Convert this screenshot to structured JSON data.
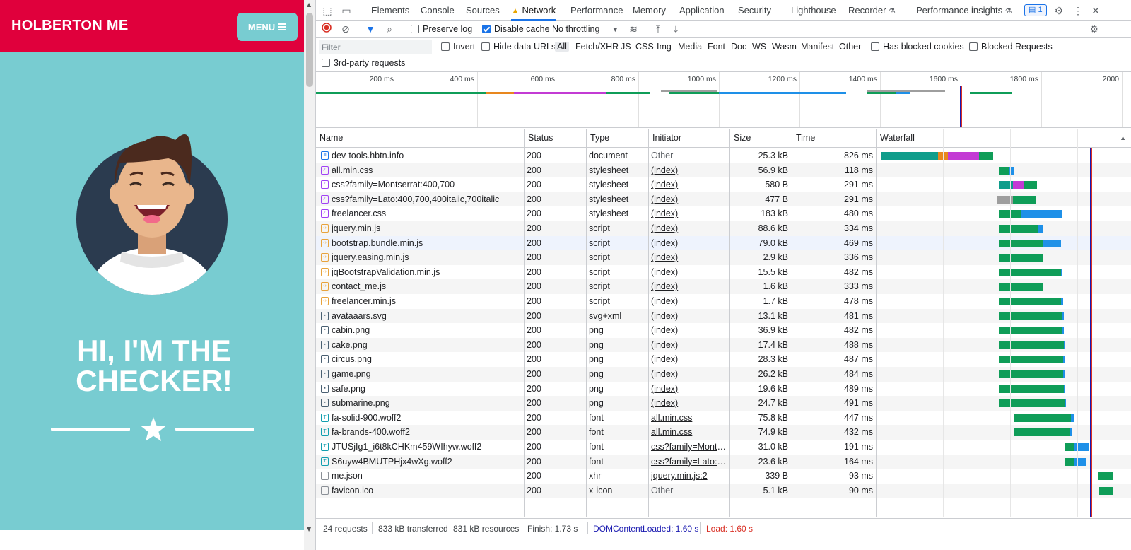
{
  "site": {
    "brand": "HOLBERTON ME",
    "menu_label": "MENU",
    "masthead_line1": "HI, I'M THE",
    "masthead_line2": "CHECKER!",
    "colors": {
      "nav": "#e0003c",
      "bg": "#78ccd1"
    }
  },
  "devtools": {
    "tabs": [
      "Elements",
      "Console",
      "Sources",
      "Network",
      "Performance",
      "Memory",
      "Application",
      "Security",
      "Lighthouse",
      "Recorder",
      "Performance insights"
    ],
    "active_tab": "Network",
    "issues_count": "1",
    "toolbar": {
      "preserve_log": "Preserve log",
      "disable_cache": "Disable cache",
      "throttling": "No throttling"
    },
    "filter": {
      "placeholder": "Filter",
      "invert": "Invert",
      "hide_data_urls": "Hide data URLs",
      "types": [
        "All",
        "Fetch/XHR",
        "JS",
        "CSS",
        "Img",
        "Media",
        "Font",
        "Doc",
        "WS",
        "Wasm",
        "Manifest",
        "Other"
      ],
      "blocked_cookies": "Has blocked cookies",
      "blocked_requests": "Blocked Requests",
      "third_party": "3rd-party requests"
    },
    "overview_labels": [
      "200 ms",
      "400 ms",
      "600 ms",
      "800 ms",
      "1000 ms",
      "1200 ms",
      "1400 ms",
      "1600 ms",
      "1800 ms",
      "2000"
    ],
    "columns": [
      "Name",
      "Status",
      "Type",
      "Initiator",
      "Size",
      "Time",
      "Waterfall"
    ],
    "requests": [
      {
        "name": "dev-tools.hbtn.info",
        "status": "200",
        "type": "document",
        "initiator": "Other",
        "size": "25.3 kB",
        "time": "826 ms",
        "kind": "doc"
      },
      {
        "name": "all.min.css",
        "status": "200",
        "type": "stylesheet",
        "initiator": "(index)",
        "size": "56.9 kB",
        "time": "118 ms",
        "kind": "css"
      },
      {
        "name": "css?family=Montserrat:400,700",
        "status": "200",
        "type": "stylesheet",
        "initiator": "(index)",
        "size": "580 B",
        "time": "291 ms",
        "kind": "css"
      },
      {
        "name": "css?family=Lato:400,700,400italic,700italic",
        "status": "200",
        "type": "stylesheet",
        "initiator": "(index)",
        "size": "477 B",
        "time": "291 ms",
        "kind": "css"
      },
      {
        "name": "freelancer.css",
        "status": "200",
        "type": "stylesheet",
        "initiator": "(index)",
        "size": "183 kB",
        "time": "480 ms",
        "kind": "css"
      },
      {
        "name": "jquery.min.js",
        "status": "200",
        "type": "script",
        "initiator": "(index)",
        "size": "88.6 kB",
        "time": "334 ms",
        "kind": "js"
      },
      {
        "name": "bootstrap.bundle.min.js",
        "status": "200",
        "type": "script",
        "initiator": "(index)",
        "size": "79.0 kB",
        "time": "469 ms",
        "kind": "js"
      },
      {
        "name": "jquery.easing.min.js",
        "status": "200",
        "type": "script",
        "initiator": "(index)",
        "size": "2.9 kB",
        "time": "336 ms",
        "kind": "js"
      },
      {
        "name": "jqBootstrapValidation.min.js",
        "status": "200",
        "type": "script",
        "initiator": "(index)",
        "size": "15.5 kB",
        "time": "482 ms",
        "kind": "js"
      },
      {
        "name": "contact_me.js",
        "status": "200",
        "type": "script",
        "initiator": "(index)",
        "size": "1.6 kB",
        "time": "333 ms",
        "kind": "js"
      },
      {
        "name": "freelancer.min.js",
        "status": "200",
        "type": "script",
        "initiator": "(index)",
        "size": "1.7 kB",
        "time": "478 ms",
        "kind": "js"
      },
      {
        "name": "avataaars.svg",
        "status": "200",
        "type": "svg+xml",
        "initiator": "(index)",
        "size": "13.1 kB",
        "time": "481 ms",
        "kind": "img"
      },
      {
        "name": "cabin.png",
        "status": "200",
        "type": "png",
        "initiator": "(index)",
        "size": "36.9 kB",
        "time": "482 ms",
        "kind": "img"
      },
      {
        "name": "cake.png",
        "status": "200",
        "type": "png",
        "initiator": "(index)",
        "size": "17.4 kB",
        "time": "488 ms",
        "kind": "img"
      },
      {
        "name": "circus.png",
        "status": "200",
        "type": "png",
        "initiator": "(index)",
        "size": "28.3 kB",
        "time": "487 ms",
        "kind": "img"
      },
      {
        "name": "game.png",
        "status": "200",
        "type": "png",
        "initiator": "(index)",
        "size": "26.2 kB",
        "time": "484 ms",
        "kind": "img"
      },
      {
        "name": "safe.png",
        "status": "200",
        "type": "png",
        "initiator": "(index)",
        "size": "19.6 kB",
        "time": "489 ms",
        "kind": "img"
      },
      {
        "name": "submarine.png",
        "status": "200",
        "type": "png",
        "initiator": "(index)",
        "size": "24.7 kB",
        "time": "491 ms",
        "kind": "img"
      },
      {
        "name": "fa-solid-900.woff2",
        "status": "200",
        "type": "font",
        "initiator": "all.min.css",
        "size": "75.8 kB",
        "time": "447 ms",
        "kind": "font"
      },
      {
        "name": "fa-brands-400.woff2",
        "status": "200",
        "type": "font",
        "initiator": "all.min.css",
        "size": "74.9 kB",
        "time": "432 ms",
        "kind": "font"
      },
      {
        "name": "JTUSjIg1_i6t8kCHKm459WIhyw.woff2",
        "status": "200",
        "type": "font",
        "initiator": "css?family=Monts...",
        "size": "31.0 kB",
        "time": "191 ms",
        "kind": "font"
      },
      {
        "name": "S6uyw4BMUTPHjx4wXg.woff2",
        "status": "200",
        "type": "font",
        "initiator": "css?family=Lato:40...",
        "size": "23.6 kB",
        "time": "164 ms",
        "kind": "font"
      },
      {
        "name": "me.json",
        "status": "200",
        "type": "xhr",
        "initiator": "jquery.min.js:2",
        "size": "339 B",
        "time": "93 ms",
        "kind": "other"
      },
      {
        "name": "favicon.ico",
        "status": "200",
        "type": "x-icon",
        "initiator": "Other",
        "size": "5.1 kB",
        "time": "90 ms",
        "kind": "other"
      }
    ],
    "summary": {
      "requests": "24 requests",
      "transferred": "833 kB transferred",
      "resources": "831 kB resources",
      "finish": "Finish: 1.73 s",
      "dom_loaded": "DOMContentLoaded: 1.60 s",
      "load": "Load: 1.60 s"
    },
    "colors": {
      "accent": "#1a73e8",
      "waiting": "#0f9d58",
      "download": "#1e90e8",
      "dom": "#1a1ab0",
      "load": "#d93025"
    }
  }
}
